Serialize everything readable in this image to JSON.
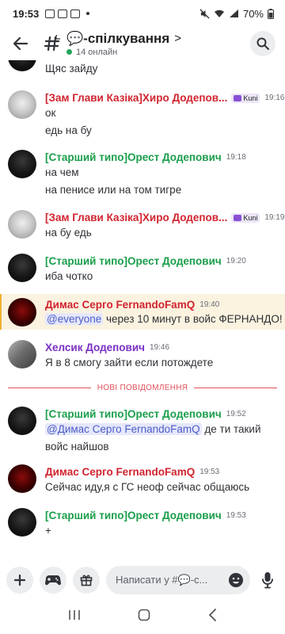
{
  "status": {
    "time": "19:53",
    "battery": "70%"
  },
  "channel": {
    "name": "💬-спілкування",
    "online": "14 онлайн"
  },
  "messages": [
    {
      "text": "Щяс зайду"
    },
    {
      "author": "[Зам Глави Казіка]Хиро Додепов...",
      "tag": "Kuni",
      "time": "19:16",
      "lines": [
        "ок",
        "едь на бу"
      ]
    },
    {
      "author": "[Старший типо]Орест Додепович",
      "time": "19:18",
      "lines": [
        "на чем",
        "на пенисе или на том тигре"
      ]
    },
    {
      "author": "[Зам Глави Казіка]Хиро Додепов...",
      "tag": "Kuni",
      "time": "19:19",
      "lines": [
        "на бу едь"
      ]
    },
    {
      "author": "[Старший типо]Орест Додепович",
      "time": "19:20",
      "lines": [
        "иба чотко"
      ]
    },
    {
      "author": "Димас Серго FernandoFamQ",
      "time": "19:40",
      "mention": "@everyone",
      "rest": " через 10 минут в войс ФЕРНАНДО!"
    },
    {
      "author": "Хелсик Додепович",
      "time": "19:46",
      "lines": [
        "Я в 8 смогу зайти если потождете"
      ]
    },
    {
      "author": "[Старший типо]Орест Додепович",
      "time": "19:52",
      "mention": "@Димас Серго FernandoFamQ",
      "rest": " де ти такий",
      "line2": "войс найшов"
    },
    {
      "author": "Димас Серго FernandoFamQ",
      "time": "19:53",
      "lines": [
        "Сейчас иду,я с ГС неоф сейчас общаюсь"
      ]
    },
    {
      "author": "[Старший типо]Орест Додепович",
      "time": "19:53",
      "lines": [
        "+"
      ]
    }
  ],
  "divider": "НОВІ ПОВІДОМЛЕННЯ",
  "composer": {
    "placeholder": "Написати у #💬-с..."
  },
  "colors": {
    "red_role": "#d1242f",
    "green_role": "#1a9e4b",
    "purple_role": "#7a2fc4",
    "mention": "#4f5dc7",
    "online": "#23a55a"
  }
}
